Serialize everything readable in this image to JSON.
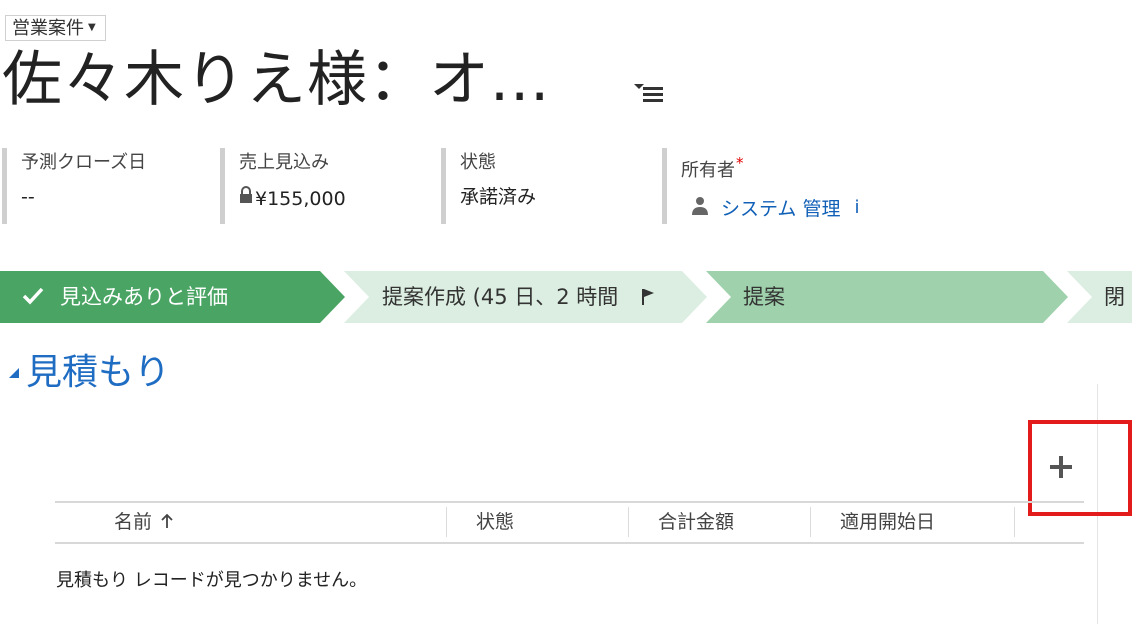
{
  "form": {
    "entity_selector_label": "営業案件",
    "record_title": "佐々木りえ様：オ..."
  },
  "header_fields": [
    {
      "label": "予測クローズ日",
      "value": "--"
    },
    {
      "label": "売上見込み",
      "value": "¥155,000"
    },
    {
      "label": "状態",
      "value": "承諾済み"
    },
    {
      "label": "所有者",
      "required_mark": "*",
      "value": "システム 管理",
      "info_icon_text": "i"
    }
  ],
  "process_bar": {
    "stages": [
      {
        "label": "見込みありと評価",
        "status": "completed",
        "icon": "checkmark-icon"
      },
      {
        "label": "提案作成 (45 日、2 時間",
        "status": "active",
        "icon": "flag-icon"
      },
      {
        "label": "提案",
        "status": "pending"
      },
      {
        "label": "閉",
        "status": "pending"
      }
    ]
  },
  "quotes_section": {
    "title": "見積もり",
    "add_icon": "plus-icon",
    "columns": [
      "名前",
      "状態",
      "合計金額",
      "適用開始日"
    ],
    "sort_icon": "arrow-up-icon",
    "empty_message": "見積もり レコードが見つかりません。"
  },
  "colors": {
    "stage_completed": "#4aa564",
    "stage_active": "#dbeee1",
    "stage_pending": "#9fd2ac",
    "link": "#1160b7",
    "section_title": "#1f6cc3",
    "highlight": "#e41b1b"
  }
}
